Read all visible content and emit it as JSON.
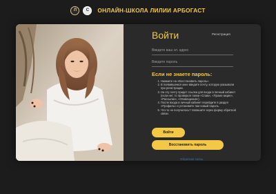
{
  "header": {
    "logo_left_text": "Л",
    "logo_right_text": "C",
    "title": "ОНЛАЙН-ШКОЛА ЛИЛИИ АРБОГАСТ"
  },
  "login": {
    "title": "Войти",
    "register_link": "Регистрация",
    "email_placeholder": "Введите ваш эл. адрес",
    "password_placeholder": "Введите пароль"
  },
  "forgot": {
    "title": "Если не знаете пароль:",
    "steps": [
      "Нажмите на «Восстановить пароль».",
      "В появившемся окне введите почту, которую указывали при регистрации.",
      "На эту почту придет ссылка для входа в личный кабинет (если нет, то проверьте папки «Спам», «Промо-акции», «Рассылки», «Оповещения»).",
      "После входа в личный кабинет перейдите в раздел «Профиль» и установите там новый пароль.",
      "Что-то не получилось? Напишите через форму обратной связи."
    ]
  },
  "buttons": {
    "login": "Войти",
    "restore": "Восстановить пароль"
  },
  "footer": {
    "link": "Обратная связь"
  },
  "colors": {
    "background": "#1c1c1c",
    "card": "#2a2a2a",
    "accent": "#f3c845"
  }
}
